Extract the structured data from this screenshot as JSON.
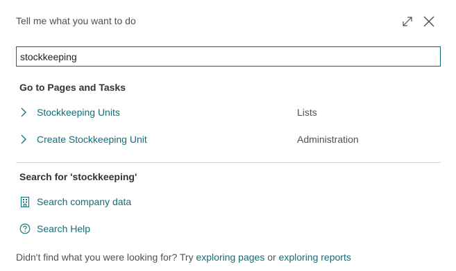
{
  "dialog": {
    "title": "Tell me what you want to do"
  },
  "search": {
    "value": "stockkeeping"
  },
  "pages_section": {
    "title": "Go to Pages and Tasks",
    "results": [
      {
        "label": "Stockkeeping Units",
        "category": "Lists"
      },
      {
        "label": "Create Stockkeeping Unit",
        "category": "Administration"
      }
    ]
  },
  "search_section": {
    "title": "Search for 'stockkeeping'",
    "company_data_label": "Search company data",
    "help_label": "Search Help"
  },
  "footer": {
    "prefix": "Didn't find what you were looking for? Try ",
    "link_pages": "exploring pages",
    "middle": " or ",
    "link_reports": "exploring reports"
  },
  "icons": {
    "expand": "expand-icon",
    "close": "close-icon",
    "chevron": "chevron-right-icon",
    "company_data": "building-icon",
    "help": "help-icon"
  },
  "colors": {
    "accent": "#0f6e7a",
    "input_border": "#0e6b7a",
    "divider": "#d6d6d6"
  }
}
